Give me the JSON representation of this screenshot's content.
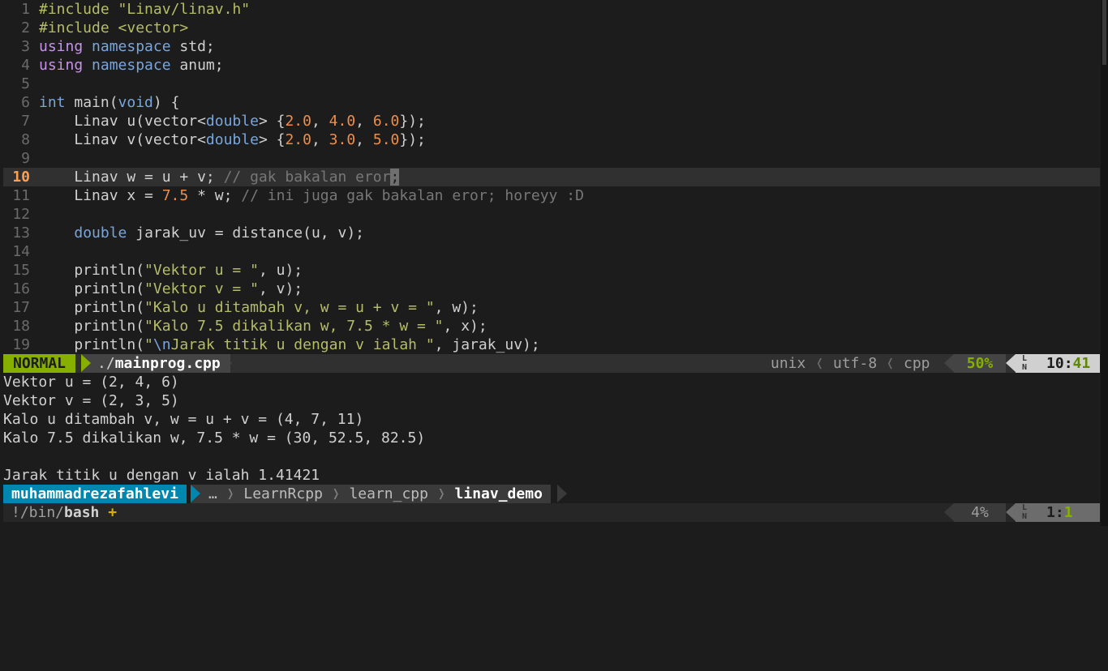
{
  "editor": {
    "lines": [
      {
        "n": "1"
      },
      {
        "n": "2"
      },
      {
        "n": "3"
      },
      {
        "n": "4"
      },
      {
        "n": "5"
      },
      {
        "n": "6"
      },
      {
        "n": "7"
      },
      {
        "n": "8"
      },
      {
        "n": "9"
      },
      {
        "n": "10"
      },
      {
        "n": "11"
      },
      {
        "n": "12"
      },
      {
        "n": "13"
      },
      {
        "n": "14"
      },
      {
        "n": "15"
      },
      {
        "n": "16"
      },
      {
        "n": "17"
      },
      {
        "n": "18"
      },
      {
        "n": "19"
      }
    ],
    "code": {
      "l1_a": "#include ",
      "l1_b": "\"Linav/linav.h\"",
      "l2_a": "#include ",
      "l2_b": "<vector>",
      "l3_kw": "using",
      "l3_ns": "namespace",
      "l3_rest": " std;",
      "l4_kw": "using",
      "l4_ns": "namespace",
      "l4_rest": " anum;",
      "l6_int": "int",
      "l6_mid": " main(",
      "l6_void": "void",
      "l6_end": ") {",
      "l7_a": "    Linav u(vector<",
      "l7_ty": "double",
      "l7_b": "> {",
      "l7_n1": "2.0",
      "l7_c1": ", ",
      "l7_n2": "4.0",
      "l7_c2": ", ",
      "l7_n3": "6.0",
      "l7_end": "});",
      "l8_a": "    Linav v(vector<",
      "l8_ty": "double",
      "l8_b": "> {",
      "l8_n1": "2.0",
      "l8_c1": ", ",
      "l8_n2": "3.0",
      "l8_c2": ", ",
      "l8_n3": "5.0",
      "l8_end": "});",
      "l10_a": "    Linav w = u + v; ",
      "l10_cm": "// gak bakalan eror",
      "l10_cur": ";",
      "l11_a": "    Linav x = ",
      "l11_n": "7.5",
      "l11_b": " * w; ",
      "l11_cm": "// ini juga gak bakalan eror; horeyy :D",
      "l13_ty": "double",
      "l13_rest": " jarak_uv = distance(u, v);",
      "l15_a": "    println(",
      "l15_s": "\"Vektor u = \"",
      "l15_b": ", u);",
      "l16_a": "    println(",
      "l16_s": "\"Vektor v = \"",
      "l16_b": ", v);",
      "l17_a": "    println(",
      "l17_s": "\"Kalo u ditambah v, w = u + v = \"",
      "l17_b": ", w);",
      "l18_a": "    println(",
      "l18_s": "\"Kalo 7.5 dikalikan w, 7.5 * w = \"",
      "l18_b": ", x);",
      "l19_a": "    println(",
      "l19_s1": "\"",
      "l19_esc": "\\n",
      "l19_s2": "Jarak titik u dengan v ialah \"",
      "l19_b": ", jarak_uv);"
    }
  },
  "statusline": {
    "mode": "NORMAL",
    "file_prefix": "./",
    "file_name": "mainprog.cpp",
    "fileformat": "unix",
    "encoding": "utf-8",
    "filetype": "cpp",
    "percent": "50%",
    "line": "10",
    "col_sep": ":",
    "col": "41"
  },
  "terminal": {
    "output": [
      "Vektor u = (2, 4, 6)",
      "Vektor v = (2, 3, 5)",
      "Kalo u ditambah v, w = u + v = (4, 7, 11)",
      "Kalo 7.5 dikalikan w, 7.5 * w = (30, 52.5, 82.5)",
      "",
      "Jarak titik u dengan v ialah 1.41421"
    ]
  },
  "prompt": {
    "user": "muhammadrezafahlevi",
    "path": [
      "…",
      "LearnRcpp",
      "learn_cpp",
      "linav_demo"
    ]
  },
  "bottom": {
    "shell_prefix": "!/bin/",
    "shell_name": "bash",
    "modified": "+",
    "percent": "4%",
    "line": "1",
    "col_sep": ":",
    "col": "1"
  },
  "icons": {
    "line_number_icon": "line-number-icon",
    "separator": "chevron-left-icon"
  }
}
